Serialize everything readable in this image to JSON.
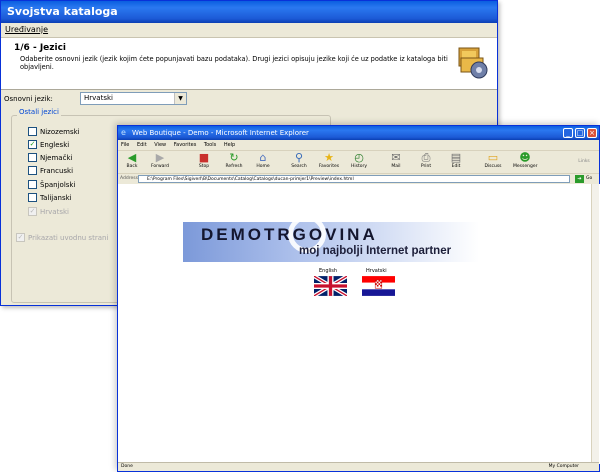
{
  "catalog_window": {
    "title": "Svojstva kataloga",
    "menu": "Uređivanje",
    "step_title": "1/6 - Jezici",
    "step_desc": "Odaberite osnovni jezik (jezik kojim ćete popunjavati bazu podataka). Drugi jezici opisuju jezike koji će uz podatke iz kataloga biti objavljeni.",
    "base_language_label": "Osnovni jezik:",
    "base_language_value": "Hrvatski",
    "group_label": "Ostali jezici",
    "languages": [
      {
        "label": "Nizozemski",
        "checked": false
      },
      {
        "label": "Engleski",
        "checked": true
      },
      {
        "label": "Njemački",
        "checked": false
      },
      {
        "label": "Francuski",
        "checked": false
      },
      {
        "label": "Španjolski",
        "checked": false
      },
      {
        "label": "Talijanski",
        "checked": false
      },
      {
        "label": "Hrvatski",
        "checked": true,
        "disabled": true
      }
    ],
    "intro_checkbox_label": "Prikazati uvodnu strani"
  },
  "ie_window": {
    "title": "Web Boutique - Demo - Microsoft Internet Explorer",
    "menu": [
      "File",
      "Edit",
      "View",
      "Favorites",
      "Tools",
      "Help"
    ],
    "toolbar": [
      {
        "label": "Back",
        "icon": "back-arrow-icon"
      },
      {
        "label": "Forward",
        "icon": "forward-arrow-icon"
      },
      {
        "label": "Stop",
        "icon": "stop-icon"
      },
      {
        "label": "Refresh",
        "icon": "refresh-icon"
      },
      {
        "label": "Home",
        "icon": "home-icon"
      },
      {
        "label": "Search",
        "icon": "search-icon"
      },
      {
        "label": "Favorites",
        "icon": "star-icon"
      },
      {
        "label": "History",
        "icon": "history-icon"
      },
      {
        "label": "Mail",
        "icon": "mail-icon"
      },
      {
        "label": "Print",
        "icon": "print-icon"
      },
      {
        "label": "Edit",
        "icon": "edit-icon"
      },
      {
        "label": "Discuss",
        "icon": "discuss-icon"
      },
      {
        "label": "Messenger",
        "icon": "messenger-icon"
      }
    ],
    "address_label": "Address",
    "address_value": "E:\\Program Files\\Sigiverl\\B\\Documents\\Catalog\\Catalogs\\ducan-primjer1\\Preview\\index.html",
    "go_label": "Go",
    "links_label": "Links",
    "logo_line1": "DEMOTRGOVINA",
    "logo_line2": "moj najbolji Internet partner",
    "flag_en_label": "English",
    "flag_hr_label": "Hrvatski",
    "status_text": "Done",
    "status_zone": "My Computer"
  }
}
